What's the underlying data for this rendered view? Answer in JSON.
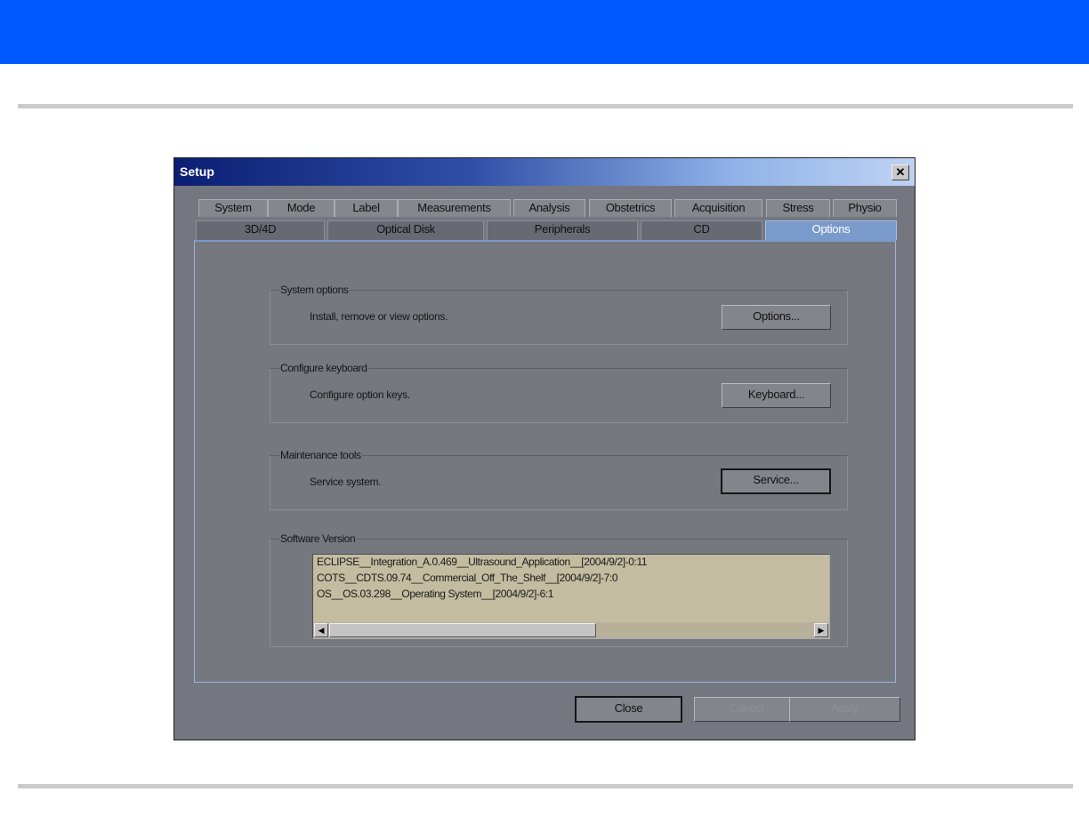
{
  "dialog": {
    "title": "Setup",
    "close_glyph": "✕"
  },
  "tabs": {
    "row1": [
      "System",
      "Mode",
      "Label",
      "Measurements",
      "Analysis",
      "Obstetrics",
      "Acquisition",
      "Stress",
      "Physio"
    ],
    "row2": [
      "3D/4D",
      "Optical Disk",
      "Peripherals",
      "CD",
      "Options"
    ],
    "active": "Options"
  },
  "groups": {
    "system_options": {
      "legend": "System options",
      "description": "Install, remove or view options.",
      "button": "Options..."
    },
    "configure_keyboard": {
      "legend": "Configure keyboard",
      "description": "Configure option keys.",
      "button": "Keyboard..."
    },
    "maintenance_tools": {
      "legend": "Maintenance tools",
      "description": "Service system.",
      "button": "Service..."
    },
    "software_version": {
      "legend": "Software Version",
      "lines": [
        "ECLIPSE__Integration_A.0.469__Ultrasound_Application__[2004/9/2]-0:11",
        "COTS__CDTS.09.74__Commercial_Off_The_Shelf__[2004/9/2]-7:0",
        "OS__OS.03.298__Operating System__[2004/9/2]-6:1"
      ]
    }
  },
  "footer": {
    "close_label": "Close",
    "cancel_label": "Cancel",
    "apply_label": "Apply"
  },
  "colors": {
    "banner": "#0058ff",
    "active_tab": "#7a9acb",
    "dialog_bg": "#767880"
  }
}
